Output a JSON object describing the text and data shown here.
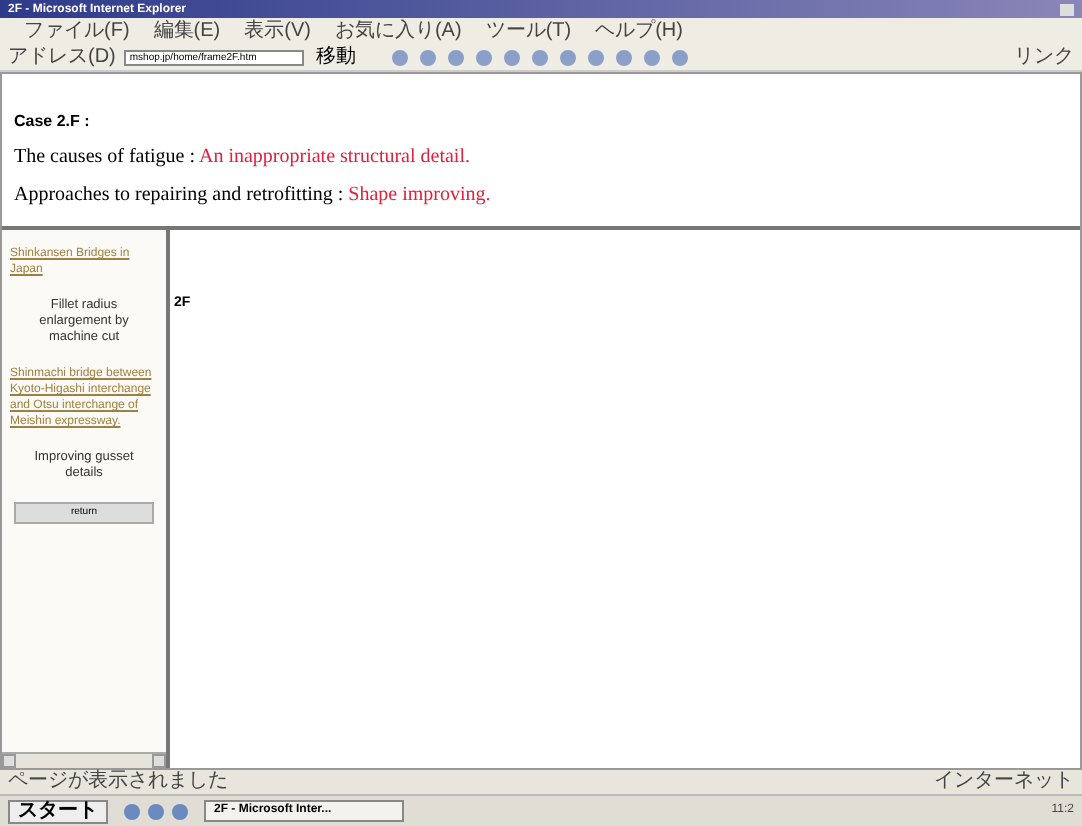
{
  "window": {
    "title": "2F - Microsoft Internet Explorer"
  },
  "menu": [
    "ファイル(F)",
    "編集(E)",
    "表示(V)",
    "お気に入り(A)",
    "ツール(T)",
    "ヘルプ(H)"
  ],
  "address_bar": {
    "label": "アドレス(D)",
    "value": "mshop.jp/home/frame2F.htm",
    "go": "移動",
    "links": "リンク"
  },
  "header": {
    "case": "Case 2.F :",
    "lines": [
      {
        "label": "The causes of fatigue : ",
        "value": "An inappropriate structural detail."
      },
      {
        "label": "Approaches to repairing and retrofitting : ",
        "value": "Shape improving."
      }
    ]
  },
  "sidebar": {
    "items": [
      {
        "kind": "link",
        "text": "Shinkansen Bridges in Japan"
      },
      {
        "kind": "caption",
        "text": "Fillet radius enlargement by machine cut"
      },
      {
        "kind": "link",
        "text": "Shinmachi bridge between Kyoto-Higashi interchange and Otsu interchange of Meishin expressway."
      },
      {
        "kind": "caption",
        "text": "Improving gusset details"
      },
      {
        "kind": "button",
        "text": "return"
      }
    ]
  },
  "main": {
    "heading": "2F"
  },
  "status_bar": {
    "text": "ページが表示されました",
    "zone": "インターネット"
  },
  "taskbar": {
    "start": "スタート",
    "task": "2F - Microsoft Inter...",
    "clock": "11:2"
  }
}
